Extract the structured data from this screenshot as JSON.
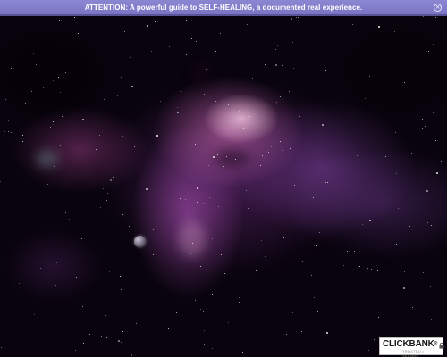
{
  "attention_bar": {
    "text": "ATTENTION: A powerful guide to SELF-HEALING, a documented real experience.",
    "close_icon": "close-icon",
    "color": "#8c87d2"
  },
  "background": {
    "type": "nebula-image",
    "colors": [
      "#08030c",
      "#e678c8",
      "#965ab4"
    ]
  },
  "badge": {
    "logo": "CLICKBANK",
    "trademark": "®",
    "subtitle": "TRUSTED • SECURE",
    "icon": "lock-icon"
  }
}
